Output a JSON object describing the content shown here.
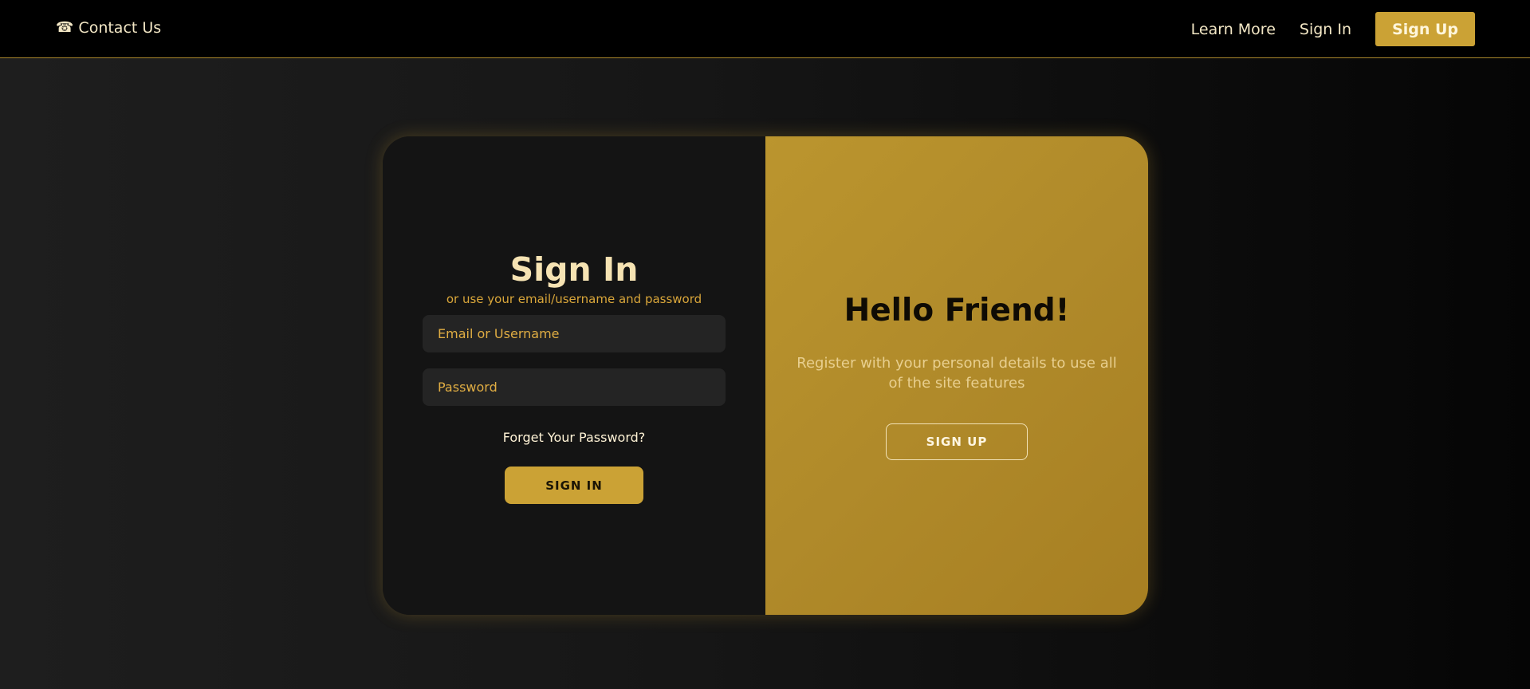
{
  "header": {
    "contact_label": "Contact Us",
    "contact_icon": "phone-icon",
    "learn_more_label": "Learn More",
    "sign_in_label": "Sign In",
    "sign_up_label": "Sign Up"
  },
  "signin_panel": {
    "title": "Sign In",
    "subtitle": "or use your email/username and password",
    "email_placeholder": "Email or Username",
    "password_placeholder": "Password",
    "forgot_label": "Forget Your Password?",
    "submit_label": "SIGN IN"
  },
  "welcome_panel": {
    "title": "Hello Friend!",
    "text": "Register with your personal details to use all of the site features",
    "signup_label": "SIGN UP"
  },
  "colors": {
    "accent": "#cba235",
    "panel_dark": "#141414",
    "topbar": "#000000"
  }
}
